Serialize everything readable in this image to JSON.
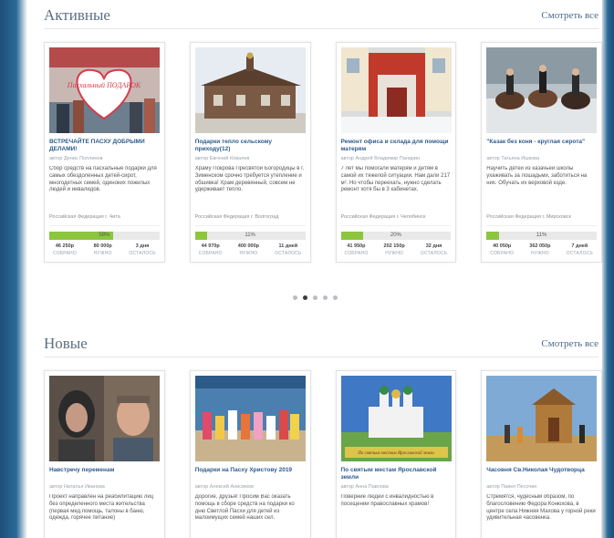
{
  "active": {
    "title": "Активные",
    "see_all": "Смотреть все",
    "cards": [
      {
        "title": "ВСТРЕЧАЙТЕ ПАСХУ ДОБРЫМИ ДЕЛАМИ!",
        "author": "автор Денис Поллинов",
        "desc": "Сбор средств на пасхальные подарки для самых обездоленных детей-сирот, многодетных семей, одиноких пожилых людей и инвалидов.",
        "location": "Российская Федерация г. Чита",
        "percent": 58,
        "percent_label": "58%",
        "collected": "46 250р",
        "needed": "80 000р",
        "left": "3 дня",
        "img_text": "Пасхальный ПОДАРОК"
      },
      {
        "title": "Подарки тепло сельскому приходу(12)",
        "author": "автор Евгений Ковалев",
        "desc": "Храму Покрова Пресвятой Богородицы в г. Зименском срочно требуется утепление и обшивка! Храм деревянный, совсем не удерживает тепло.",
        "location": "Российская Федерация г. Волгоград",
        "percent": 11,
        "percent_label": "11%",
        "collected": "44 970р",
        "needed": "400 000р",
        "left": "11 дней"
      },
      {
        "title": "Ремонт офиса и склада для помощи матерям",
        "author": "автор Андрей Владимир Панарин",
        "desc": "7 лет мы помогали матерям и детям в самой их тяжелой ситуации. Нам дали 217 м². Но чтобы переехать, нужно сделать ремонт хотя бы в 3 кабинетах.",
        "location": "Российская Федерация г. Челябинск",
        "percent": 20,
        "percent_label": "20%",
        "collected": "41 950р",
        "needed": "202 150р",
        "left": "32 дня"
      },
      {
        "title": "\"Казак без коня - круглая сирота\"",
        "author": "автор Татьяна Ишкова",
        "desc": "Научить детей из казачьей школы ухаживать за лошадьми, заботиться на них. Обучать их верховой езде.",
        "location": "Российская Федерация г. Мирсковск",
        "percent": 11,
        "percent_label": "11%",
        "collected": "40 050р",
        "needed": "362 050р",
        "left": "7 дней"
      }
    ],
    "labels": {
      "collected": "СОБРАНО",
      "needed": "НУЖНО",
      "left": "ОСТАЛОСЬ"
    }
  },
  "new": {
    "title": "Новые",
    "see_all": "Смотреть все",
    "cards": [
      {
        "title": "Навстречу переменам",
        "author": "автор Наталья Иванова",
        "desc": "Проект направлен на реабилитацию лиц без определенного места жительства (первая мед.помощь, талоны в баню, одежда, горячее питание)"
      },
      {
        "title": "Подарки на Пасху Христову 2019",
        "author": "автор Алексей Анисимов",
        "desc": "Дорогие, друзья! Просим Вас оказать помощь в сборе средств на подарки ко дню Светлой Пасхи для детей из малоимущих семей наших сел."
      },
      {
        "title": "По святым местам Ярославской земли",
        "author": "автор Анна Павлова",
        "desc": "Поверние людей с инвалидностью в посещении православных храмов!",
        "img_text": "По святым местам Ярославской земли"
      },
      {
        "title": "Часовня Св.Николая Чудотворца",
        "author": "автор Павел Песочин",
        "desc": "Стремятся, чудесным образом, по благословению Федора Конюхова, в центре села Нижняя Махова у горной реки удивительная часовенка."
      }
    ]
  },
  "carousel": {
    "count": 5,
    "active_index": 1
  }
}
